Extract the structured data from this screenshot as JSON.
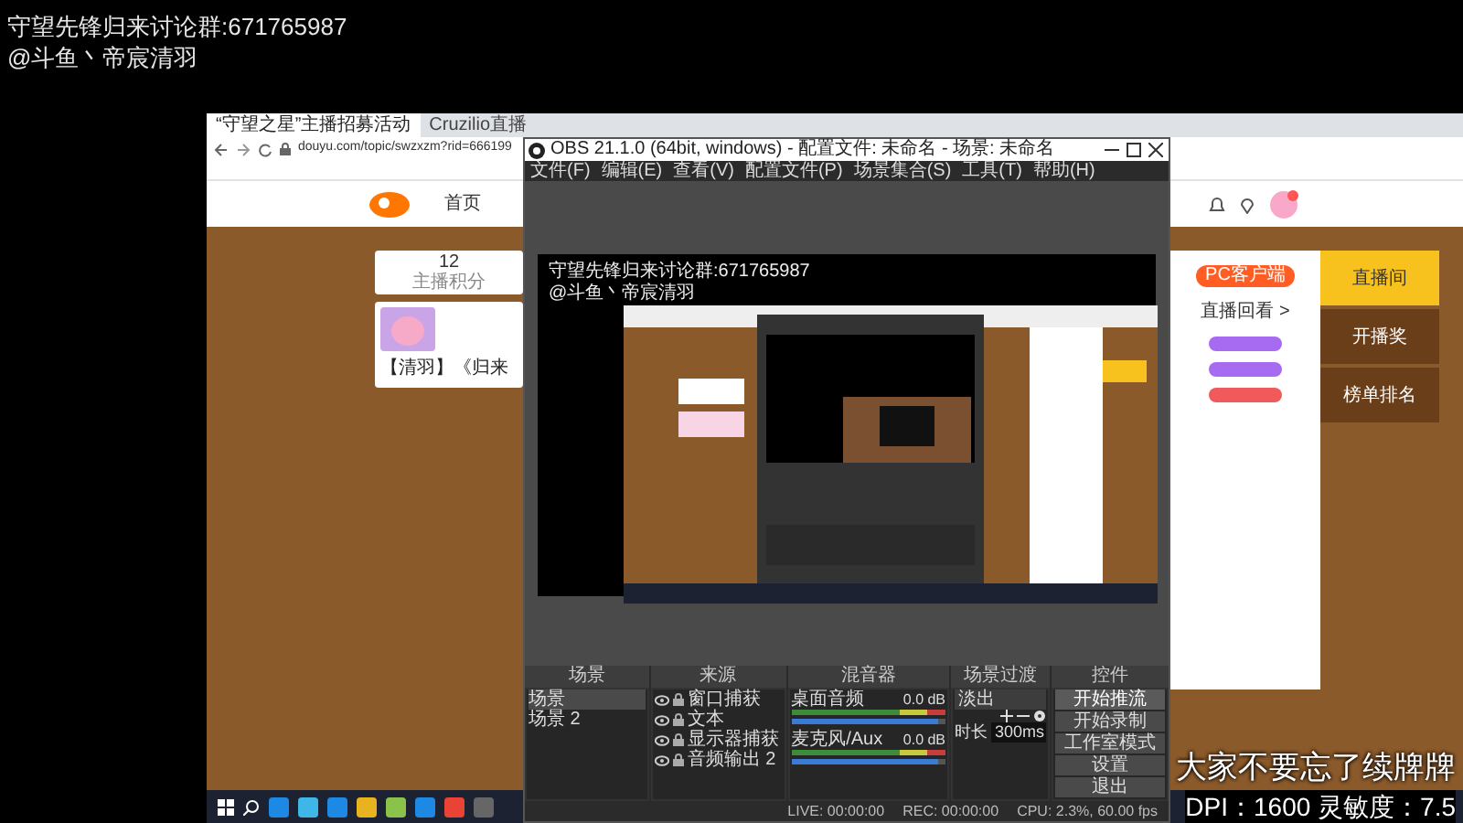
{
  "stream_overlay": [
    "守望先锋归来讨论群:671765987",
    "@斗鱼丶帝宸清羽"
  ],
  "browser": {
    "tabs": [
      {
        "label": "“守望之星”主播招募活动",
        "selected": true
      },
      {
        "label": "Cruzilio直播",
        "selected": false
      }
    ],
    "url": "douyu.com/topic/swzxzm?rid=666199",
    "nav": [
      {
        "label": "首页",
        "selected": false
      }
    ],
    "stat": {
      "value": "12",
      "label": "主播积分"
    },
    "video_title": "【清羽】《归来",
    "pc_client_button": "PC客户端",
    "replay_link": "直播回看 >",
    "side_menu": [
      {
        "label": "直播间",
        "selected": true
      },
      {
        "label": "开播奖",
        "selected": false
      },
      {
        "label": "榜单排名",
        "selected": false
      }
    ]
  },
  "obs": {
    "title": "OBS 21.1.0 (64bit, windows) - 配置文件: 未命名 - 场景: 未命名",
    "menu": [
      "文件(F)",
      "编辑(E)",
      "查看(V)",
      "配置文件(P)",
      "场景集合(S)",
      "工具(T)",
      "帮助(H)"
    ],
    "preview_overlay": [
      "守望先锋归来讨论群:671765987",
      "@斗鱼丶帝宸清羽"
    ],
    "docks": [
      "场景",
      "来源",
      "混音器",
      "场景过渡",
      "控件"
    ],
    "scenes": [
      {
        "label": "场景",
        "selected": true
      },
      {
        "label": "场景 2",
        "selected": false
      }
    ],
    "sources": [
      "窗口捕获",
      "文本",
      "显示器捕获",
      "音频输出 2"
    ],
    "mixer": [
      {
        "name": "桌面音频",
        "reading": "0.0 dB",
        "level": 0.95
      },
      {
        "name": "麦克风/Aux",
        "reading": "0.0 dB",
        "level": 0.95
      }
    ],
    "transition": {
      "type": "淡出",
      "duration_label": "时长",
      "duration": "300ms"
    },
    "controls": [
      {
        "label": "开始推流",
        "selected": true
      },
      {
        "label": "开始录制",
        "selected": false
      },
      {
        "label": "工作室模式",
        "selected": false
      },
      {
        "label": "设置",
        "selected": false
      },
      {
        "label": "退出",
        "selected": false
      }
    ],
    "status": [
      "LIVE: 00:00:00",
      "REC: 00:00:00",
      "CPU: 2.3%, 60.00 fps"
    ]
  },
  "caption": "大家不要忘了续牌牌",
  "dpi_line": "DPI：1600 灵敏度：7.5"
}
